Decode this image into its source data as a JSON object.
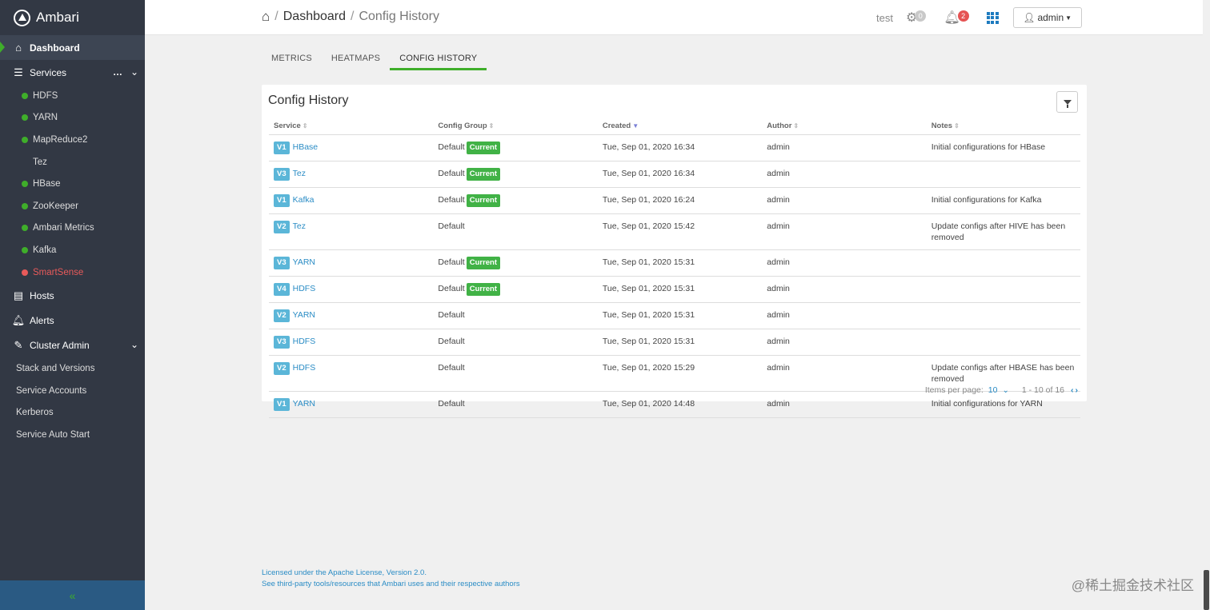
{
  "brand": {
    "name": "Ambari",
    "icon": "ambari-logo-icon"
  },
  "sidebar": {
    "dashboard": "Dashboard",
    "services": "Services",
    "service_items": [
      {
        "label": "HDFS",
        "status": "green"
      },
      {
        "label": "YARN",
        "status": "green"
      },
      {
        "label": "MapReduce2",
        "status": "green"
      },
      {
        "label": "Tez",
        "status": "none"
      },
      {
        "label": "HBase",
        "status": "green"
      },
      {
        "label": "ZooKeeper",
        "status": "green"
      },
      {
        "label": "Ambari Metrics",
        "status": "green"
      },
      {
        "label": "Kafka",
        "status": "green"
      },
      {
        "label": "SmartSense",
        "status": "red"
      }
    ],
    "hosts": "Hosts",
    "alerts": "Alerts",
    "cluster_admin": "Cluster Admin",
    "admin_items": [
      "Stack and Versions",
      "Service Accounts",
      "Kerberos",
      "Service Auto Start"
    ],
    "collapse": "«"
  },
  "header": {
    "crumb_dashboard": "Dashboard",
    "crumb_current": "Config History",
    "cluster": "test",
    "ops_count": "0",
    "alerts_count": "2",
    "user": "admin"
  },
  "tabs": [
    "METRICS",
    "HEATMAPS",
    "CONFIG HISTORY"
  ],
  "panel": {
    "title": "Config History",
    "columns": [
      "Service",
      "Config Group",
      "Created",
      "Author",
      "Notes"
    ],
    "rows": [
      {
        "version": "V1",
        "service": "HBase",
        "group": "Default",
        "current": "Current",
        "created": "Tue, Sep 01, 2020 16:34",
        "author": "admin",
        "notes": "Initial configurations for HBase"
      },
      {
        "version": "V3",
        "service": "Tez",
        "group": "Default",
        "current": "Current",
        "created": "Tue, Sep 01, 2020 16:34",
        "author": "admin",
        "notes": ""
      },
      {
        "version": "V1",
        "service": "Kafka",
        "group": "Default",
        "current": "Current",
        "created": "Tue, Sep 01, 2020 16:24",
        "author": "admin",
        "notes": "Initial configurations for Kafka"
      },
      {
        "version": "V2",
        "service": "Tez",
        "group": "Default",
        "current": "",
        "created": "Tue, Sep 01, 2020 15:42",
        "author": "admin",
        "notes": "Update configs after HIVE has been removed"
      },
      {
        "version": "V3",
        "service": "YARN",
        "group": "Default",
        "current": "Current",
        "created": "Tue, Sep 01, 2020 15:31",
        "author": "admin",
        "notes": ""
      },
      {
        "version": "V4",
        "service": "HDFS",
        "group": "Default",
        "current": "Current",
        "created": "Tue, Sep 01, 2020 15:31",
        "author": "admin",
        "notes": ""
      },
      {
        "version": "V2",
        "service": "YARN",
        "group": "Default",
        "current": "",
        "created": "Tue, Sep 01, 2020 15:31",
        "author": "admin",
        "notes": ""
      },
      {
        "version": "V3",
        "service": "HDFS",
        "group": "Default",
        "current": "",
        "created": "Tue, Sep 01, 2020 15:31",
        "author": "admin",
        "notes": ""
      },
      {
        "version": "V2",
        "service": "HDFS",
        "group": "Default",
        "current": "",
        "created": "Tue, Sep 01, 2020 15:29",
        "author": "admin",
        "notes": "Update configs after HBASE has been removed"
      },
      {
        "version": "V1",
        "service": "YARN",
        "group": "Default",
        "current": "",
        "created": "Tue, Sep 01, 2020 14:48",
        "author": "admin",
        "notes": "Initial configurations for YARN"
      }
    ],
    "pager": {
      "items_per_page_label": "Items per page:",
      "items_per_page": "10",
      "range": "1 - 10 of 16"
    }
  },
  "footer": {
    "license": "Licensed under the Apache License, Version 2.0.",
    "thirdparty": "See third-party tools/resources that Ambari uses and their respective authors"
  },
  "watermark": "@稀土掘金技术社区",
  "colors": {
    "sidebar_bg": "#323844",
    "accent_green": "#3fae2a",
    "link_blue": "#2a8cc5",
    "current_badge": "#41b246",
    "version_badge": "#5bb6d8"
  }
}
